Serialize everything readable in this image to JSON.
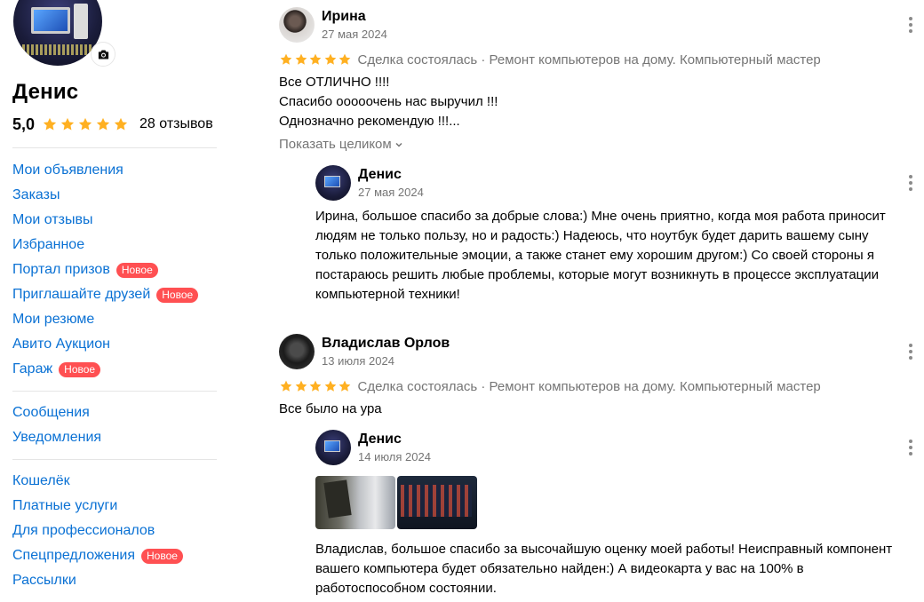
{
  "profile": {
    "name": "Денис",
    "rating": "5,0",
    "stars": 5,
    "reviews_count": "28 отзывов"
  },
  "menu_groups": [
    [
      {
        "label": "Мои объявления",
        "badge": ""
      },
      {
        "label": "Заказы",
        "badge": ""
      },
      {
        "label": "Мои отзывы",
        "badge": ""
      },
      {
        "label": "Избранное",
        "badge": ""
      },
      {
        "label": "Портал призов",
        "badge": "Новое"
      },
      {
        "label": "Приглашайте друзей",
        "badge": "Новое"
      },
      {
        "label": "Мои резюме",
        "badge": ""
      },
      {
        "label": "Авито Аукцион",
        "badge": ""
      },
      {
        "label": "Гараж",
        "badge": "Новое"
      }
    ],
    [
      {
        "label": "Сообщения",
        "badge": ""
      },
      {
        "label": "Уведомления",
        "badge": ""
      }
    ],
    [
      {
        "label": "Кошелёк",
        "badge": ""
      },
      {
        "label": "Платные услуги",
        "badge": ""
      },
      {
        "label": "Для профессионалов",
        "badge": ""
      },
      {
        "label": "Спецпредложения",
        "badge": "Новое"
      },
      {
        "label": "Рассылки",
        "badge": ""
      }
    ]
  ],
  "colors": {
    "accent": "#0a71d4",
    "star": "#ffb021",
    "badge": "#ff5052"
  },
  "reviews": [
    {
      "author": "Ирина",
      "date": "27 мая 2024",
      "stars": 5,
      "deal": "Сделка состоялась · Ремонт компьютеров на дому. Компьютерный мастер",
      "lines": [
        "Все ОТЛИЧНО !!!!",
        "Спасибо ооооочень нас выручил !!!",
        "Однозначно рекомендую !!!..."
      ],
      "show_full": "Показать целиком",
      "reply": {
        "author": "Денис",
        "date": "27 мая 2024",
        "lines": [
          "Ирина, большое спасибо за добрые слова:) Мне очень приятно, когда моя работа приносит",
          "людям не только пользу, но и радость:) Надеюсь, что ноутбук будет дарить вашему сыну",
          "только положительные эмоции, а также станет ему хорошим другом:) Со своей стороны я",
          "постараюсь решить любые проблемы, которые могут возникнуть в процессе эксплуатации",
          "компьютерной техники!"
        ]
      }
    },
    {
      "author": "Владислав Орлов",
      "date": "13 июля 2024",
      "stars": 5,
      "deal": "Сделка состоялась · Ремонт компьютеров на дому. Компьютерный мастер",
      "lines": [
        "Все было на ура"
      ],
      "reply": {
        "author": "Денис",
        "date": "14 июля 2024",
        "lines": [
          "Владислав, большое спасибо за высочайшую оценку моей работы! Неисправный компонент",
          "вашего компьютера будет обязательно найден:) А видеокарта у вас на 100% в",
          "работоспособном состоянии."
        ]
      }
    }
  ]
}
